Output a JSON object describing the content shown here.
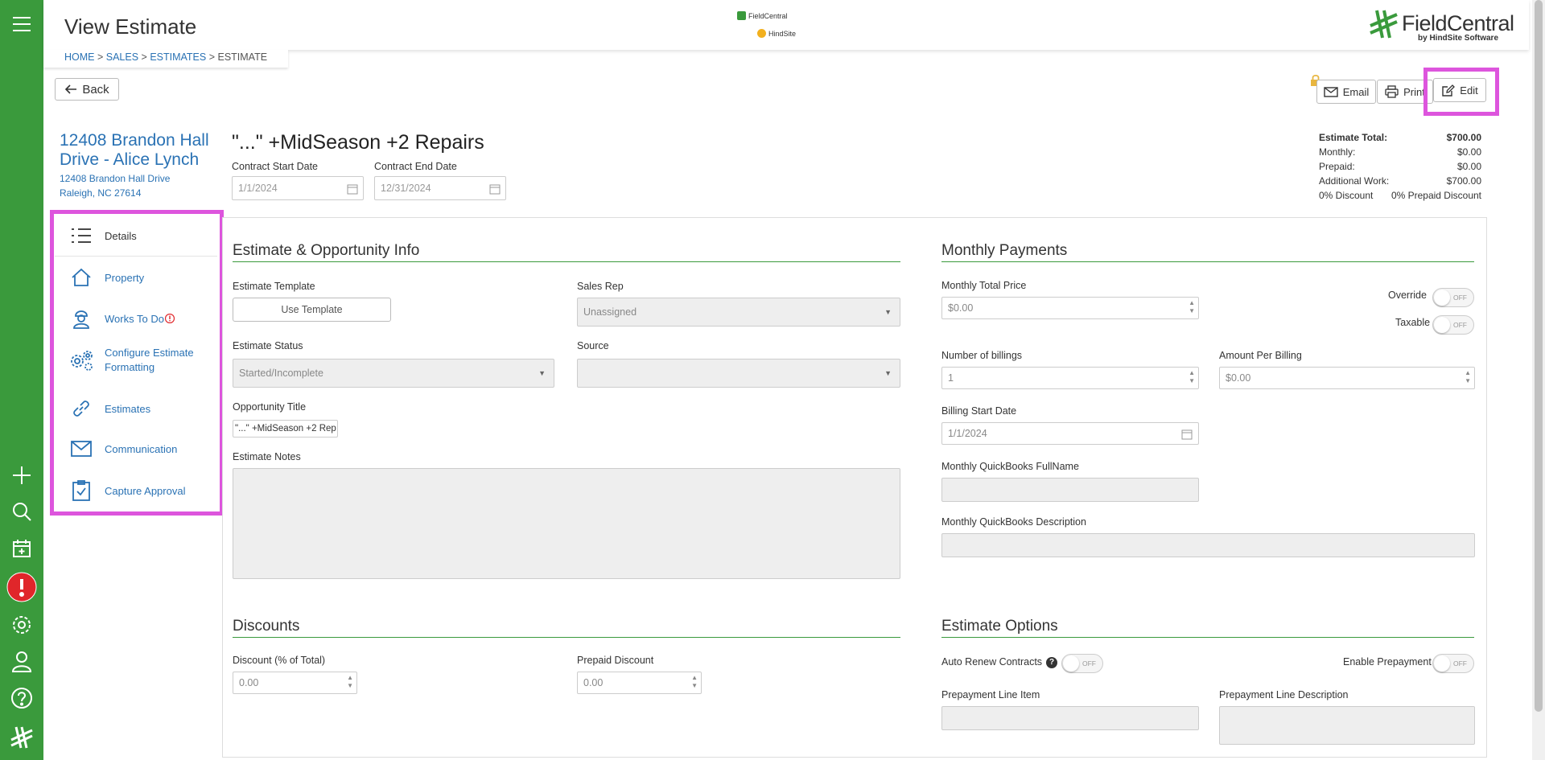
{
  "header": {
    "title": "View Estimate",
    "center_logo_top": "FieldCentral",
    "center_logo_bottom": "HindSite",
    "brand_name": "FieldCentral",
    "brand_sub": "by HindSite Software"
  },
  "breadcrumb": {
    "home": "HOME",
    "sales": "SALES",
    "estimates": "ESTIMATES",
    "current": "ESTIMATE",
    "sep": " > "
  },
  "toolbar": {
    "back_label": "Back",
    "email_label": "Email",
    "print_label": "Print",
    "edit_label": "Edit"
  },
  "customer": {
    "title_line1": "12408 Brandon Hall",
    "title_line2": "Drive - Alice Lynch",
    "address1": "12408 Brandon Hall Drive",
    "address2": "Raleigh, NC 27614"
  },
  "estimate": {
    "name": "\"...\" +MidSeason +2 Repairs",
    "start_label": "Contract Start Date",
    "start_value": "1/1/2024",
    "end_label": "Contract End Date",
    "end_value": "12/31/2024"
  },
  "summary": {
    "total_label": "Estimate Total:",
    "total_value": "$700.00",
    "monthly_label": "Monthly:",
    "monthly_value": "$0.00",
    "prepaid_label": "Prepaid:",
    "prepaid_value": "$0.00",
    "additional_label": "Additional Work:",
    "additional_value": "$700.00",
    "discount_text": "0%  Discount",
    "prepaid_discount_text": "0%  Prepaid Discount"
  },
  "sidebar": {
    "items": [
      {
        "label": "Details"
      },
      {
        "label": "Property"
      },
      {
        "label": "Works To Do"
      },
      {
        "label": "Configure Estimate Formatting"
      },
      {
        "label": "Estimates"
      },
      {
        "label": "Communication"
      },
      {
        "label": "Capture Approval"
      }
    ]
  },
  "info": {
    "title": "Estimate & Opportunity Info",
    "template_label": "Estimate Template",
    "template_button": "Use Template",
    "salesrep_label": "Sales Rep",
    "salesrep_value": "Unassigned",
    "status_label": "Estimate Status",
    "status_value": "Started/Incomplete",
    "source_label": "Source",
    "source_value": "",
    "opp_title_label": "Opportunity Title",
    "opp_title_value": "\"...\" +MidSeason +2 Rep",
    "notes_label": "Estimate Notes"
  },
  "monthly": {
    "title": "Monthly Payments",
    "total_price_label": "Monthly Total Price",
    "total_price_value": "$0.00",
    "override_label": "Override",
    "taxable_label": "Taxable",
    "billings_label": "Number of billings",
    "billings_value": "1",
    "per_billing_label": "Amount Per Billing",
    "per_billing_value": "$0.00",
    "billing_start_label": "Billing Start Date",
    "billing_start_value": "1/1/2024",
    "qb_fullname_label": "Monthly QuickBooks FullName",
    "qb_desc_label": "Monthly QuickBooks Description"
  },
  "discounts": {
    "title": "Discounts",
    "discount_label": "Discount (% of Total)",
    "discount_value": "0.00",
    "prepaid_label": "Prepaid Discount",
    "prepaid_value": "0.00"
  },
  "options": {
    "title": "Estimate Options",
    "auto_renew_label": "Auto Renew Contracts",
    "enable_prepay_label": "Enable Prepayment",
    "prepay_line_label": "Prepayment Line Item",
    "prepay_desc_label": "Prepayment Line Description"
  },
  "toggles": {
    "off_text": "OFF"
  },
  "colors": {
    "brand_green": "#3a9a3c",
    "link_blue": "#2a72b4",
    "highlight": "#dd55dd",
    "alert_red": "#e0262a"
  }
}
